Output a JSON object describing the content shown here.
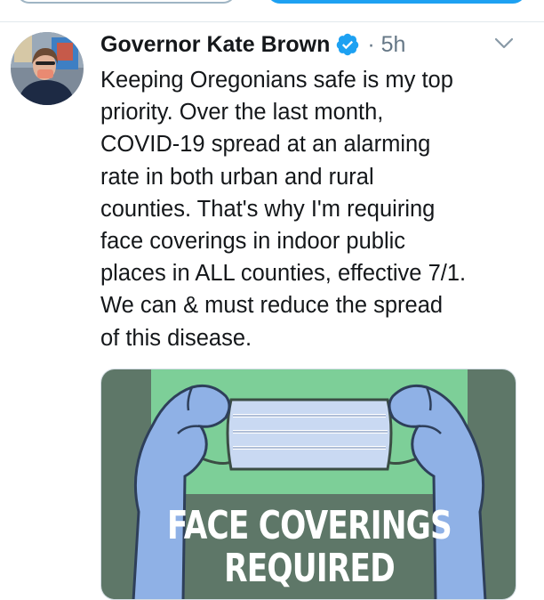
{
  "tweet": {
    "author_name": "Governor Kate Brown",
    "time_prefix": "·",
    "time_ago": "5h",
    "text_lines": [
      "Keeping Oregonians safe is my top",
      "priority. Over the last month,",
      "COVID-19 spread at an alarming",
      "rate in both urban and rural",
      "counties. That's why I'm requiring",
      "face coverings in indoor public",
      "places in ALL counties, effective 7/1.",
      "We can & must reduce the spread",
      "of this disease."
    ]
  },
  "media": {
    "title_line1": "FACE COVERINGS",
    "title_line2": "REQUIRED"
  },
  "icons": {
    "verified": "verified-badge-icon",
    "menu": "chevron-down-icon"
  },
  "colors": {
    "twitter_blue": "#1da1f2",
    "text": "#14171a",
    "secondary_text": "#657786",
    "sign_dark_green": "#5e7768",
    "sign_light_green": "#7dcf98",
    "glove_blue": "#8fb1e6",
    "mask_blue": "#c9d9f2"
  }
}
